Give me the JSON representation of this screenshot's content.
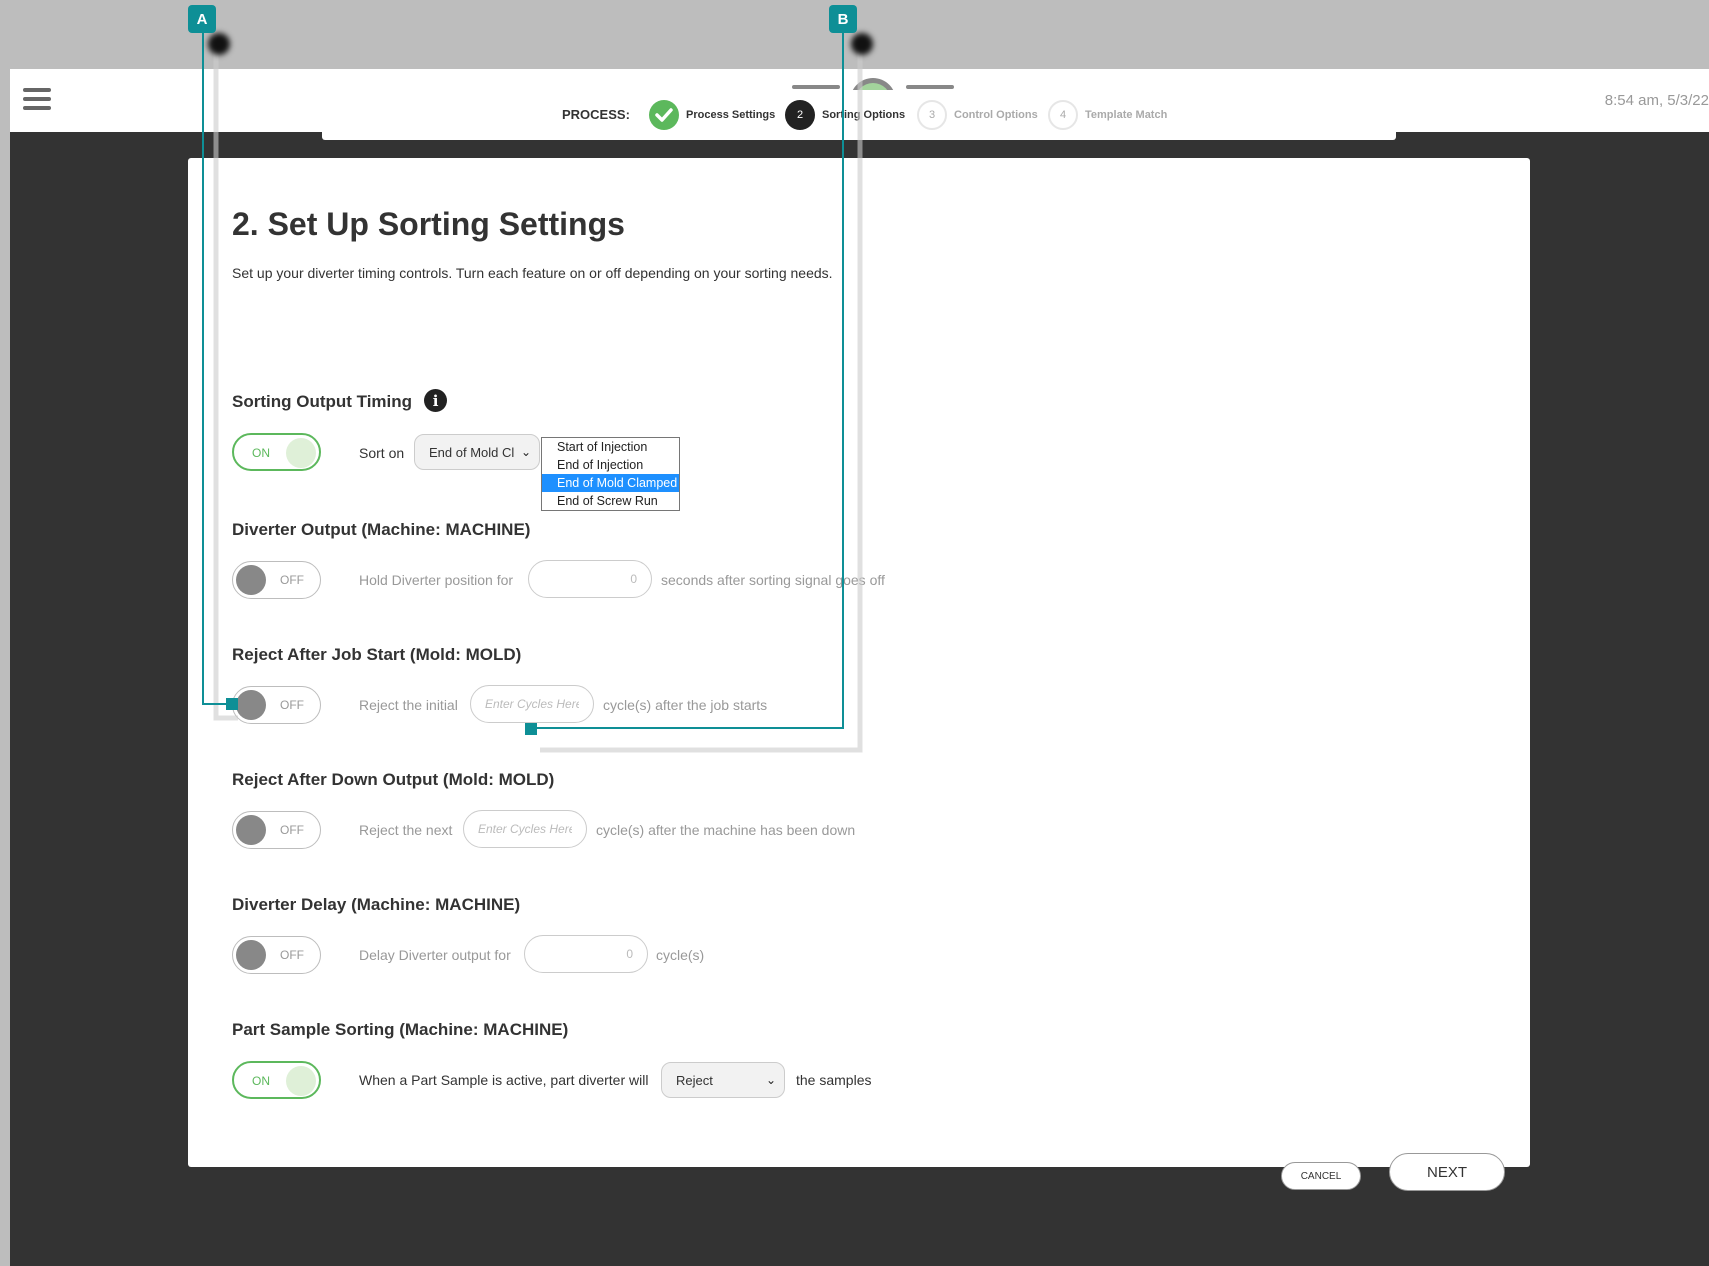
{
  "header": {
    "clock": "8:54 am, 5/3/22"
  },
  "stepper": {
    "label": "PROCESS:",
    "steps": [
      {
        "number": "",
        "name": "Process Settings",
        "state": "done"
      },
      {
        "number": "2",
        "name": "Sorting Options",
        "state": "active"
      },
      {
        "number": "3",
        "name": "Control Options",
        "state": "todo"
      },
      {
        "number": "4",
        "name": "Template Match",
        "state": "todo"
      }
    ]
  },
  "page": {
    "title": "2. Set Up Sorting Settings",
    "description": "Set up your diverter timing controls. Turn each feature on or off depending on your sorting needs."
  },
  "sections": {
    "sorting_output_timing": {
      "title": "Sorting Output Timing",
      "toggle": "ON",
      "text_before": "Sort on",
      "select_value": "End of Mold Cl",
      "options": [
        "Start of Injection",
        "End of Injection",
        "End of Mold Clamped",
        "End of Screw Run"
      ],
      "selected_option": "End of Mold Clamped"
    },
    "diverter_output": {
      "title": "Diverter Output (Machine: MACHINE)",
      "toggle": "OFF",
      "text_before": "Hold Diverter position for",
      "value": "0",
      "text_after": "seconds after sorting signal goes off"
    },
    "reject_after_job_start": {
      "title": "Reject After Job Start (Mold: MOLD)",
      "toggle": "OFF",
      "text_before": "Reject the initial",
      "placeholder": "Enter Cycles Here",
      "text_after": "cycle(s) after the job starts"
    },
    "reject_after_down_output": {
      "title": "Reject After Down Output (Mold: MOLD)",
      "toggle": "OFF",
      "text_before": "Reject the next",
      "placeholder": "Enter Cycles Here",
      "text_after": "cycle(s) after the machine has been down"
    },
    "diverter_delay": {
      "title": "Diverter Delay (Machine: MACHINE)",
      "toggle": "OFF",
      "text_before": "Delay Diverter output for",
      "value": "0",
      "text_after": "cycle(s)"
    },
    "part_sample_sorting": {
      "title": "Part Sample Sorting (Machine: MACHINE)",
      "toggle": "ON",
      "text_before": "When a Part Sample is active, part diverter will",
      "select_value": "Reject",
      "text_after": "the samples"
    }
  },
  "buttons": {
    "cancel": "CANCEL",
    "next": "NEXT"
  },
  "callouts": {
    "a": "A",
    "b": "B"
  },
  "colors": {
    "accent_green": "#5cb85c",
    "callout_teal": "#0e8f96",
    "selection_blue": "#1e90ff",
    "backdrop_dark": "#333333"
  }
}
